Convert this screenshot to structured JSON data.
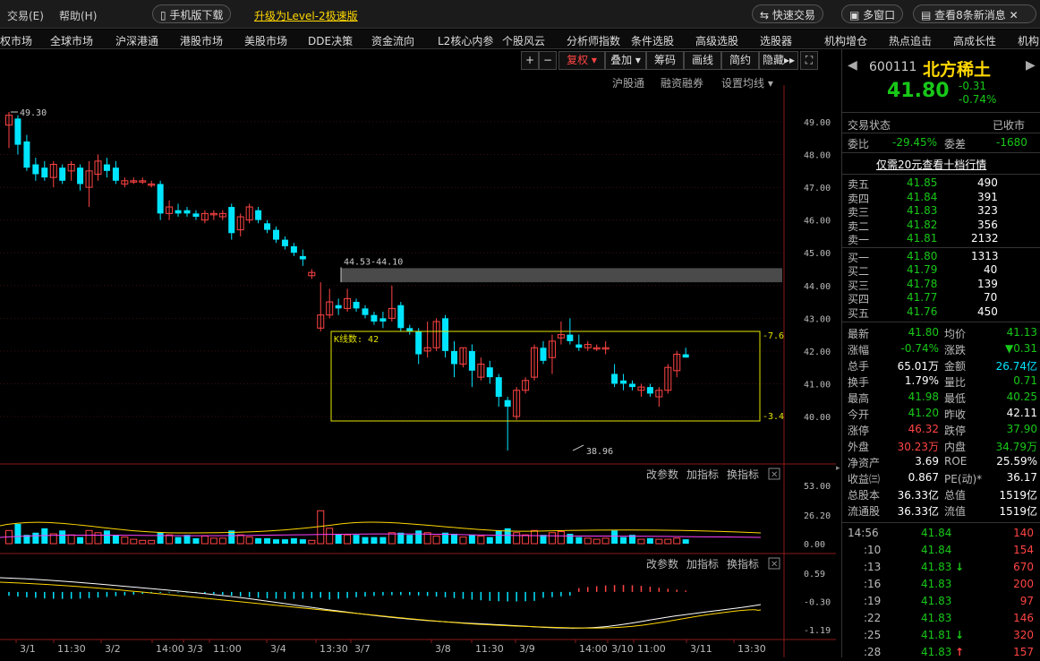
{
  "topbar": {
    "menu_trade": "交易(E)",
    "menu_help": "帮助(H)",
    "mobile_download": "手机版下载",
    "upgrade": "升级为Level-2极速版",
    "quick_trade": "快速交易",
    "multi_window": "多窗口",
    "news": "查看8条新消息"
  },
  "nav": [
    "权市场",
    "全球市场",
    "沪深港通",
    "港股市场",
    "美股市场",
    "DDE决策",
    "资金流向",
    "L2核心内参",
    "个股风云",
    "分析师指数",
    "条件选股",
    "高级选股",
    "选股器",
    "机构增仓",
    "热点追击",
    "高成长性",
    "机构"
  ],
  "toolbar": {
    "plus": "+",
    "minus": "−",
    "fuquan": "复权",
    "diejia": "叠加",
    "chouma": "筹码",
    "huaxian": "画线",
    "jianyue": "简约",
    "yincang": "隐藏"
  },
  "sub_links": {
    "hgt": "沪股通",
    "rzrq": "融资融券",
    "avg": "设置均线"
  },
  "price_axis": [
    "49.00",
    "48.00",
    "47.00",
    "46.00",
    "45.00",
    "44.00",
    "43.00",
    "42.00",
    "41.00",
    "40.00"
  ],
  "annotations": {
    "high_label": "49.30",
    "low_label": "38.96",
    "gap_label": "44.53-44.10",
    "box_label": "K线数: 42",
    "box_right_top": "-7.6",
    "box_right_bottom": "-3.4"
  },
  "vol_panel": {
    "links": [
      "改参数",
      "加指标",
      "换指标"
    ],
    "axis": [
      "53.00",
      "26.20",
      "0.00"
    ]
  },
  "macd_panel": {
    "links": [
      "改参数",
      "加指标",
      "换指标"
    ],
    "axis": [
      "0.59",
      "-0.30",
      "-1.19"
    ]
  },
  "time_axis": [
    "3/1",
    "11:30",
    "3/2",
    "14:00",
    "3/3",
    "11:00",
    "3/4",
    "13:30",
    "3/7",
    "3/8",
    "11:30",
    "3/9",
    "14:00",
    "3/10",
    "11:00",
    "3/11",
    "13:30"
  ],
  "quote": {
    "code": "600111",
    "name": "北方稀土",
    "price": "41.80",
    "change": "-0.31",
    "change_pct": "-0.74%",
    "status_label": "交易状态",
    "status_value": "已收市",
    "weibi_label": "委比",
    "weibi": "-29.45%",
    "weicha_label": "委差",
    "weicha": "-1680",
    "promo": "仅需20元查看十档行情",
    "asks": [
      {
        "label": "卖五",
        "price": "41.85",
        "vol": "490"
      },
      {
        "label": "卖四",
        "price": "41.84",
        "vol": "391"
      },
      {
        "label": "卖三",
        "price": "41.83",
        "vol": "323"
      },
      {
        "label": "卖二",
        "price": "41.82",
        "vol": "356"
      },
      {
        "label": "卖一",
        "price": "41.81",
        "vol": "2132"
      }
    ],
    "bids": [
      {
        "label": "买一",
        "price": "41.80",
        "vol": "1313"
      },
      {
        "label": "买二",
        "price": "41.79",
        "vol": "40"
      },
      {
        "label": "买三",
        "price": "41.78",
        "vol": "139"
      },
      {
        "label": "买四",
        "price": "41.77",
        "vol": "70"
      },
      {
        "label": "买五",
        "price": "41.76",
        "vol": "450"
      }
    ],
    "stats": [
      {
        "l1": "最新",
        "v1": "41.80",
        "c1": "green",
        "l2": "均价",
        "v2": "41.13",
        "c2": "green"
      },
      {
        "l1": "涨幅",
        "v1": "-0.74%",
        "c1": "green",
        "l2": "涨跌",
        "v2": "▼0.31",
        "c2": "green"
      },
      {
        "l1": "总手",
        "v1": "65.01万",
        "c1": "white",
        "l2": "金额",
        "v2": "26.74亿",
        "c2": "cyan"
      },
      {
        "l1": "换手",
        "v1": "1.79%",
        "c1": "white",
        "l2": "量比",
        "v2": "0.71",
        "c2": "green"
      },
      {
        "l1": "最高",
        "v1": "41.98",
        "c1": "green",
        "l2": "最低",
        "v2": "40.25",
        "c2": "green"
      },
      {
        "l1": "今开",
        "v1": "41.20",
        "c1": "green",
        "l2": "昨收",
        "v2": "42.11",
        "c2": "white"
      },
      {
        "l1": "涨停",
        "v1": "46.32",
        "c1": "red",
        "l2": "跌停",
        "v2": "37.90",
        "c2": "green"
      },
      {
        "l1": "外盘",
        "v1": "30.23万",
        "c1": "red",
        "l2": "内盘",
        "v2": "34.79万",
        "c2": "green"
      },
      {
        "l1": "净资产",
        "v1": "3.69",
        "c1": "white",
        "l2": "ROE",
        "v2": "25.59%",
        "c2": "white"
      },
      {
        "l1": "收益㈢",
        "v1": "0.867",
        "c1": "white",
        "l2": "PE(动)*",
        "v2": "36.17",
        "c2": "white"
      },
      {
        "l1": "总股本",
        "v1": "36.33亿",
        "c1": "white",
        "l2": "总值",
        "v2": "1519亿",
        "c2": "white"
      },
      {
        "l1": "流通股",
        "v1": "36.33亿",
        "c1": "white",
        "l2": "流值",
        "v2": "1519亿",
        "c2": "white"
      }
    ],
    "ticks": [
      {
        "t": "14:56",
        "p": "41.84",
        "v": "140",
        "arrow": ""
      },
      {
        "t": ":10",
        "p": "41.84",
        "v": "154",
        "arrow": ""
      },
      {
        "t": ":13",
        "p": "41.83",
        "v": "670",
        "arrow": "down"
      },
      {
        "t": ":16",
        "p": "41.83",
        "v": "200",
        "arrow": ""
      },
      {
        "t": ":19",
        "p": "41.83",
        "v": "97",
        "arrow": ""
      },
      {
        "t": ":22",
        "p": "41.83",
        "v": "146",
        "arrow": ""
      },
      {
        "t": ":25",
        "p": "41.81",
        "v": "320",
        "arrow": "down"
      },
      {
        "t": ":28",
        "p": "41.83",
        "v": "157",
        "arrow": "up"
      }
    ]
  },
  "colors": {
    "up": "#ff4444",
    "down": "#00e5ff",
    "box": "#e6e600",
    "ma_white": "#ffffff",
    "ma_yellow": "#ffd700",
    "ma_magenta": "#ff40ff"
  }
}
